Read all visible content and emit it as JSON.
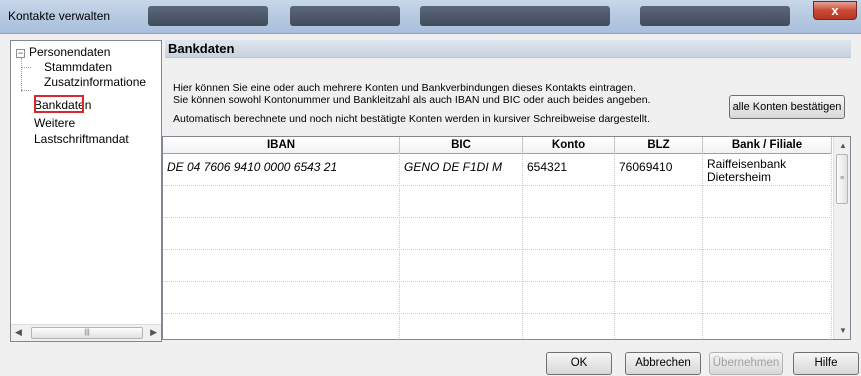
{
  "window": {
    "title": "Kontakte verwalten",
    "close_label": "x"
  },
  "tree": {
    "expander": "−",
    "items": [
      {
        "label": "Personendaten"
      },
      {
        "label": "Stammdaten"
      },
      {
        "label": "Zusatzinformatione"
      },
      {
        "label": "Bankdaten",
        "selected": true
      },
      {
        "label": "Weitere"
      },
      {
        "label": "Lastschriftmandat"
      }
    ]
  },
  "panel": {
    "title": "Bankdaten",
    "info_line1": "Hier können Sie eine oder auch mehrere Konten und Bankverbindungen dieses Kontakts eintragen.",
    "info_line2": "Sie können sowohl Kontonummer und Bankleitzahl als auch IBAN und BIC oder auch beides angeben.",
    "info_line3": "Automatisch berechnete und noch nicht bestätigte Konten werden in kursiver Schreibweise dargestellt.",
    "confirm_all_label": "alle Konten bestätigen"
  },
  "table": {
    "columns": [
      "IBAN",
      "BIC",
      "Konto",
      "BLZ",
      "Bank / Filiale"
    ],
    "rows": [
      {
        "iban": "DE 04 7606 9410 0000 6543 21",
        "bic": "GENO DE F1DI M",
        "konto": "654321",
        "blz": "76069410",
        "bank": "Raiffeisenbank Dietersheim"
      },
      {
        "iban": "",
        "bic": "",
        "konto": "",
        "blz": "",
        "bank": ""
      },
      {
        "iban": "",
        "bic": "",
        "konto": "",
        "blz": "",
        "bank": ""
      },
      {
        "iban": "",
        "bic": "",
        "konto": "",
        "blz": "",
        "bank": ""
      },
      {
        "iban": "",
        "bic": "",
        "konto": "",
        "blz": "",
        "bank": ""
      },
      {
        "iban": "",
        "bic": "",
        "konto": "",
        "blz": "",
        "bank": ""
      }
    ]
  },
  "buttons": {
    "ok": "OK",
    "cancel": "Abbrechen",
    "apply": "Übernehmen",
    "help": "Hilfe"
  },
  "colors": {
    "selection_outline": "#d9282d",
    "close_button": "#c94a35"
  }
}
